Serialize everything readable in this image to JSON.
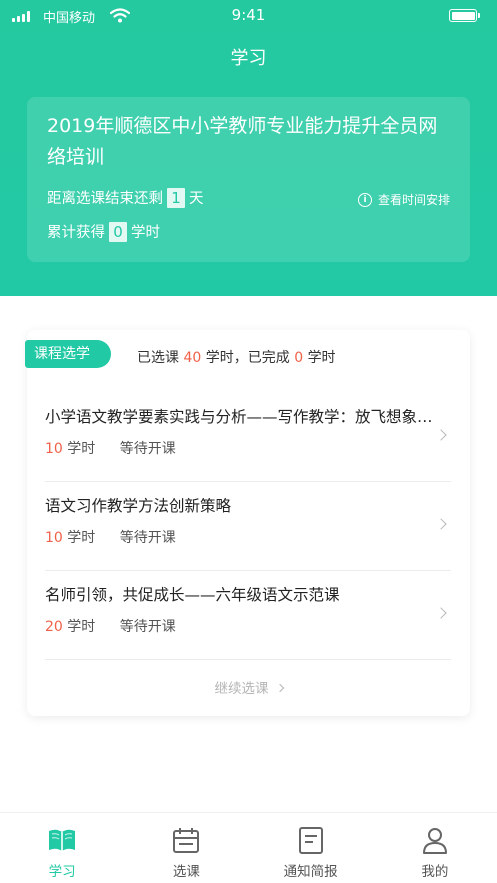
{
  "status_bar": {
    "carrier": "中国移动",
    "time": "9:41"
  },
  "header": {
    "title": "学习"
  },
  "training": {
    "title": "2019年顺德区中小学教师专业能力提升全员网络培训",
    "countdown_prefix": "距离选课结束还剩",
    "countdown_value": "1",
    "countdown_suffix": "天",
    "earned_prefix": "累计获得",
    "earned_value": "0",
    "earned_suffix": "学时",
    "schedule_link": "查看时间安排"
  },
  "course_selection": {
    "tag": "课程选学",
    "summary": {
      "selected_prefix": "已选课",
      "selected_hours": "40",
      "middle": "学时，已完成",
      "completed_hours": "0",
      "suffix": "学时"
    },
    "courses": [
      {
        "name": "小学语文教学要素实践与分析——写作教学：放飞想象，自由表达",
        "hours": "10",
        "unit": "学时",
        "status": "等待开课"
      },
      {
        "name": "语文习作教学方法创新策略",
        "hours": "10",
        "unit": "学时",
        "status": "等待开课"
      },
      {
        "name": "名师引领，共促成长——六年级语文示范课",
        "hours": "20",
        "unit": "学时",
        "status": "等待开课"
      }
    ],
    "more_label": "继续选课"
  },
  "tabbar": {
    "items": [
      {
        "label": "学习",
        "icon": "book-icon",
        "active": true
      },
      {
        "label": "选课",
        "icon": "calendar-icon",
        "active": false
      },
      {
        "label": "通知简报",
        "icon": "document-icon",
        "active": false
      },
      {
        "label": "我的",
        "icon": "user-icon",
        "active": false
      }
    ]
  },
  "colors": {
    "primary": "#22c9a5",
    "highlight": "#f0614a"
  }
}
